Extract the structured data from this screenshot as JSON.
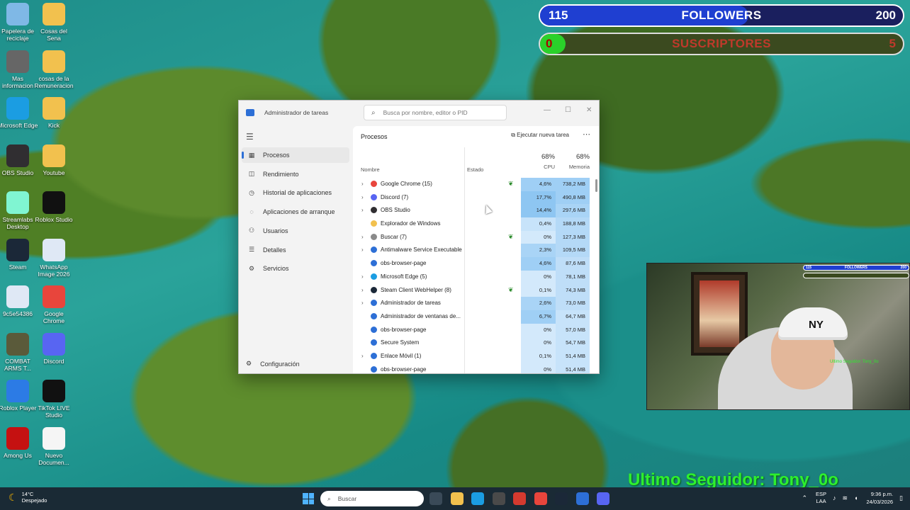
{
  "desktop": {
    "icons": [
      {
        "label": "Papelera de reciclaje",
        "icon": "recycle-bin-icon",
        "color": "#7fb8e6"
      },
      {
        "label": "Cosas del Sena",
        "icon": "folder-icon",
        "color": "#f2c14e"
      },
      {
        "label": "Mas informacion",
        "icon": "info-icon",
        "color": "#666666"
      },
      {
        "label": "cosas de la Remuneracion",
        "icon": "folder-icon",
        "color": "#f2c14e"
      },
      {
        "label": "Microsoft Edge",
        "icon": "edge-icon",
        "color": "#1b9de2"
      },
      {
        "label": "Kick",
        "icon": "folder-icon",
        "color": "#f2c14e"
      },
      {
        "label": "OBS Studio",
        "icon": "obs-icon",
        "color": "#302e31"
      },
      {
        "label": "Youtube",
        "icon": "folder-icon",
        "color": "#f2c14e"
      },
      {
        "label": "Streamlabs Desktop",
        "icon": "streamlabs-icon",
        "color": "#80f5d2"
      },
      {
        "label": "Roblox Studio",
        "icon": "roblox-studio-icon",
        "color": "#111111"
      },
      {
        "label": "Steam",
        "icon": "steam-icon",
        "color": "#1b2838"
      },
      {
        "label": "WhatsApp Image 2026",
        "icon": "image-file-icon",
        "color": "#dfe8f5"
      },
      {
        "label": "9c5e54386",
        "icon": "image-file-icon",
        "color": "#dfe8f5"
      },
      {
        "label": "Google Chrome",
        "icon": "chrome-icon",
        "color": "#e8453c"
      },
      {
        "label": "COMBAT ARMS T...",
        "icon": "combat-arms-icon",
        "color": "#5a5a3a"
      },
      {
        "label": "Discord",
        "icon": "discord-icon",
        "color": "#5865f2"
      },
      {
        "label": "Roblox Player",
        "icon": "roblox-icon",
        "color": "#2c7be5"
      },
      {
        "label": "TikTok LIVE Studio",
        "icon": "tiktok-icon",
        "color": "#111111"
      },
      {
        "label": "Among Us",
        "icon": "among-us-icon",
        "color": "#c51111"
      },
      {
        "label": "Nuevo Documen...",
        "icon": "document-icon",
        "color": "#f5f5f5"
      }
    ]
  },
  "overlay": {
    "followers": {
      "current": "115",
      "label": "FOLLOWERS",
      "goal": "200",
      "progress": 0.575,
      "color": "#1f3fd1"
    },
    "subs": {
      "current": "0",
      "label": "SUSCRIPTORES",
      "goal": "5",
      "progress": 0.0,
      "color": "#c0392b"
    },
    "last_follower": "Ultimo Seguidor: Tony_0o"
  },
  "webcam": {
    "mini_followers": {
      "current": "115",
      "label": "FOLLOWERS",
      "goal": "200"
    },
    "mini_last_follower": "Ultimo Seguidor: Tony_0o",
    "cap_logo": "NY"
  },
  "taskmgr": {
    "title": "Administrador de tareas",
    "search_placeholder": "Busca por nombre, editor o PID",
    "nav": [
      {
        "label": "Procesos",
        "icon": "grid-icon",
        "glyph": "▦"
      },
      {
        "label": "Rendimiento",
        "icon": "performance-icon",
        "glyph": "◫"
      },
      {
        "label": "Historial de aplicaciones",
        "icon": "history-icon",
        "glyph": "◷"
      },
      {
        "label": "Aplicaciones de arranque",
        "icon": "startup-icon",
        "glyph": "◌"
      },
      {
        "label": "Usuarios",
        "icon": "users-icon",
        "glyph": "⚇"
      },
      {
        "label": "Detalles",
        "icon": "details-icon",
        "glyph": "☰"
      },
      {
        "label": "Servicios",
        "icon": "services-icon",
        "glyph": "⚙"
      }
    ],
    "settings_label": "Configuración",
    "header": "Procesos",
    "run_task": "Ejecutar nueva tarea",
    "columns": {
      "name": "Nombre",
      "status": "Estado",
      "cpu_pct": "68%",
      "cpu": "CPU",
      "mem_pct": "68%",
      "mem": "Memoria"
    },
    "processes": [
      {
        "name": "Google Chrome (15)",
        "expand": true,
        "eco": true,
        "cpu": "4,6%",
        "mem": "738,2 MB",
        "icon": "chrome-icon",
        "color": "#e8453c",
        "cpu_heat": "#9fcff5",
        "mem_heat": "#9fcff5"
      },
      {
        "name": "Discord (7)",
        "expand": true,
        "eco": false,
        "cpu": "17,7%",
        "mem": "490,8 MB",
        "icon": "discord-icon",
        "color": "#5865f2",
        "cpu_heat": "#8ec6f2",
        "mem_heat": "#9fcff5"
      },
      {
        "name": "OBS Studio",
        "expand": true,
        "eco": false,
        "cpu": "14,4%",
        "mem": "297,6 MB",
        "icon": "obs-icon",
        "color": "#302e31",
        "cpu_heat": "#8ec6f2",
        "mem_heat": "#a9d4f6"
      },
      {
        "name": "Explorador de Windows",
        "expand": false,
        "eco": false,
        "cpu": "0,4%",
        "mem": "188,8 MB",
        "icon": "folder-icon",
        "color": "#f2c14e",
        "cpu_heat": "#c7e3fa",
        "mem_heat": "#b4d9f7"
      },
      {
        "name": "Buscar (7)",
        "expand": true,
        "eco": true,
        "cpu": "0%",
        "mem": "127,3 MB",
        "icon": "search-icon",
        "color": "#8a8a8a",
        "cpu_heat": "#d3e9fb",
        "mem_heat": "#b4d9f7"
      },
      {
        "name": "Antimalware Service Executable",
        "expand": true,
        "eco": false,
        "cpu": "2,3%",
        "mem": "109,5 MB",
        "icon": "shield-icon",
        "color": "#2d6fd6",
        "cpu_heat": "#a9d4f6",
        "mem_heat": "#b4d9f7"
      },
      {
        "name": "obs-browser-page",
        "expand": false,
        "eco": false,
        "cpu": "4,6%",
        "mem": "87,6 MB",
        "icon": "app-icon",
        "color": "#2d6fd6",
        "cpu_heat": "#9fcff5",
        "mem_heat": "#bfdef8"
      },
      {
        "name": "Microsoft Edge (5)",
        "expand": true,
        "eco": false,
        "cpu": "0%",
        "mem": "78,1 MB",
        "icon": "edge-icon",
        "color": "#1b9de2",
        "cpu_heat": "#d3e9fb",
        "mem_heat": "#bfdef8"
      },
      {
        "name": "Steam Client WebHelper (8)",
        "expand": true,
        "eco": true,
        "cpu": "0,1%",
        "mem": "74,3 MB",
        "icon": "steam-icon",
        "color": "#1b2838",
        "cpu_heat": "#d3e9fb",
        "mem_heat": "#bfdef8"
      },
      {
        "name": "Administrador de tareas",
        "expand": true,
        "eco": false,
        "cpu": "2,6%",
        "mem": "73,0 MB",
        "icon": "task-manager-icon",
        "color": "#2d6fd6",
        "cpu_heat": "#a9d4f6",
        "mem_heat": "#bfdef8"
      },
      {
        "name": "Administrador de ventanas de...",
        "expand": false,
        "eco": false,
        "cpu": "6,7%",
        "mem": "64,7 MB",
        "icon": "app-icon",
        "color": "#2d6fd6",
        "cpu_heat": "#9fcff5",
        "mem_heat": "#c7e3fa"
      },
      {
        "name": "obs-browser-page",
        "expand": false,
        "eco": false,
        "cpu": "0%",
        "mem": "57,0 MB",
        "icon": "app-icon",
        "color": "#2d6fd6",
        "cpu_heat": "#d3e9fb",
        "mem_heat": "#c7e3fa"
      },
      {
        "name": "Secure System",
        "expand": false,
        "eco": false,
        "cpu": "0%",
        "mem": "54,7 MB",
        "icon": "app-icon",
        "color": "#2d6fd6",
        "cpu_heat": "#d3e9fb",
        "mem_heat": "#c7e3fa"
      },
      {
        "name": "Enlace Móvil (1)",
        "expand": true,
        "eco": false,
        "cpu": "0,1%",
        "mem": "51,4 MB",
        "icon": "phone-link-icon",
        "color": "#2d6fd6",
        "cpu_heat": "#d3e9fb",
        "mem_heat": "#c7e3fa"
      },
      {
        "name": "obs-browser-page",
        "expand": false,
        "eco": false,
        "cpu": "0%",
        "mem": "51,4 MB",
        "icon": "app-icon",
        "color": "#2d6fd6",
        "cpu_heat": "#d3e9fb",
        "mem_heat": "#c7e3fa"
      }
    ]
  },
  "taskbar": {
    "weather_temp": "14°C",
    "weather_text": "Despejado",
    "search_placeholder": "Buscar",
    "apps": [
      {
        "icon": "task-view-icon",
        "color": "#3a4a58"
      },
      {
        "icon": "file-explorer-icon",
        "color": "#f2c14e"
      },
      {
        "icon": "edge-icon",
        "color": "#1b9de2"
      },
      {
        "icon": "store-icon",
        "color": "#4a4a4a"
      },
      {
        "icon": "app-red-icon",
        "color": "#d43a2f"
      },
      {
        "icon": "chrome-icon",
        "color": "#e8453c"
      },
      {
        "icon": "steam-icon",
        "color": "#1b2838"
      },
      {
        "icon": "task-manager-icon",
        "color": "#2d6fd6"
      },
      {
        "icon": "discord-icon",
        "color": "#5865f2"
      }
    ],
    "lang_top": "ESP",
    "lang_bottom": "LAA",
    "time": "9:36 p.m.",
    "date": "24/03/2026"
  }
}
